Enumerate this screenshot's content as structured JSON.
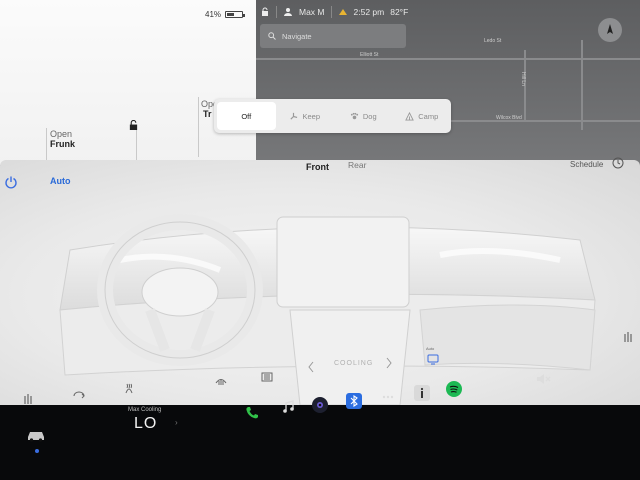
{
  "status": {
    "battery_percent": "41%",
    "profile_name": "Max M",
    "time": "2:52 pm",
    "temperature": "82°F"
  },
  "vehicle": {
    "trunk_label_open": "Open",
    "trunk_label_partial": "Tr",
    "frunk_label_open": "Open",
    "frunk_label_name": "Frunk"
  },
  "map": {
    "search_placeholder": "Navigate",
    "streets": [
      "Elliott St",
      "Ledo St",
      "Hill Ln",
      "Wilcox Blvd"
    ]
  },
  "climate_modes": {
    "items": [
      {
        "label": "Off",
        "icon": "off",
        "active": true
      },
      {
        "label": "Keep",
        "icon": "fan-icon",
        "active": false
      },
      {
        "label": "Dog",
        "icon": "dog-icon",
        "active": false
      },
      {
        "label": "Camp",
        "icon": "tent-icon",
        "active": false
      }
    ]
  },
  "climate": {
    "auto_label": "Auto",
    "tab_front": "Front",
    "tab_rear": "Rear",
    "schedule_label": "Schedule",
    "cooling_label": "COOLING",
    "auto_small": "Auto"
  },
  "dock": {
    "max_cooling_label": "Max Cooling",
    "temperature": "LO",
    "apps": [
      "phone-icon",
      "music-icon",
      "camera-icon",
      "bluetooth-icon",
      "more-icon",
      "info-icon",
      "spotify-icon"
    ],
    "accent_blue": "#3a6de0",
    "phone_green": "#31c24a",
    "spotify_green": "#1db954"
  }
}
